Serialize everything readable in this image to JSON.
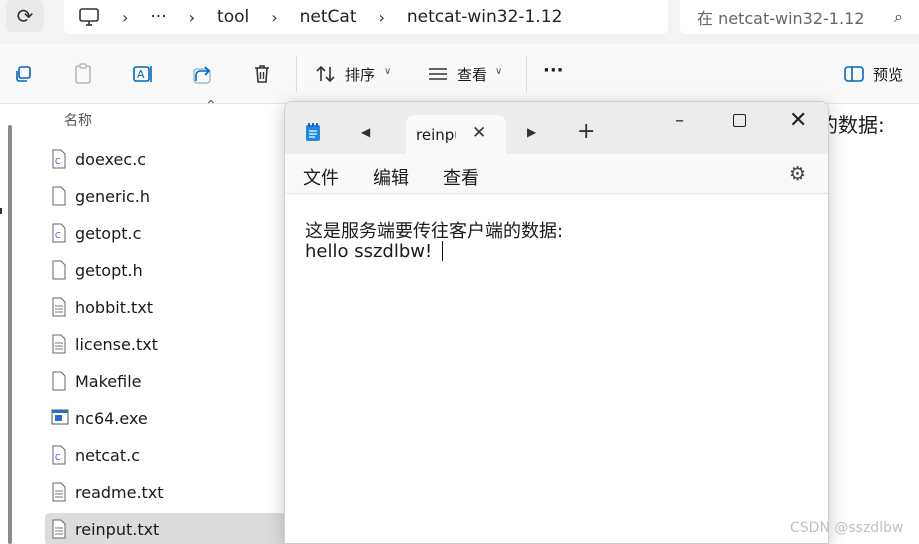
{
  "explorer": {
    "breadcrumbs": [
      "···",
      "tool",
      "netCat",
      "netcat-win32-1.12"
    ],
    "search_placeholder": "在 netcat-win32-1.12",
    "commands": {
      "sort_label": "排序",
      "view_label": "查看",
      "more_label": "···",
      "preview_label": "预览"
    },
    "column_header": "名称",
    "files": [
      {
        "name": "doexec.c",
        "type": "c"
      },
      {
        "name": "generic.h",
        "type": "h"
      },
      {
        "name": "getopt.c",
        "type": "c"
      },
      {
        "name": "getopt.h",
        "type": "h"
      },
      {
        "name": "hobbit.txt",
        "type": "txt"
      },
      {
        "name": "license.txt",
        "type": "txt"
      },
      {
        "name": "Makefile",
        "type": "file"
      },
      {
        "name": "nc64.exe",
        "type": "exe"
      },
      {
        "name": "netcat.c",
        "type": "c"
      },
      {
        "name": "readme.txt",
        "type": "txt"
      },
      {
        "name": "reinput.txt",
        "type": "txt",
        "selected": true
      }
    ],
    "behind_text": "的数据:"
  },
  "notepad": {
    "tab_title": "reinput",
    "menu": [
      "文件",
      "编辑",
      "查看"
    ],
    "content_lines": [
      "这是服务端要传往客户端的数据:",
      "hello sszdlbw!"
    ]
  },
  "watermark": "CSDN @sszdlbw",
  "colors": {
    "accent": "#0067c0",
    "selected_row": "#dcdcdc",
    "titlebar": "#ececec"
  }
}
